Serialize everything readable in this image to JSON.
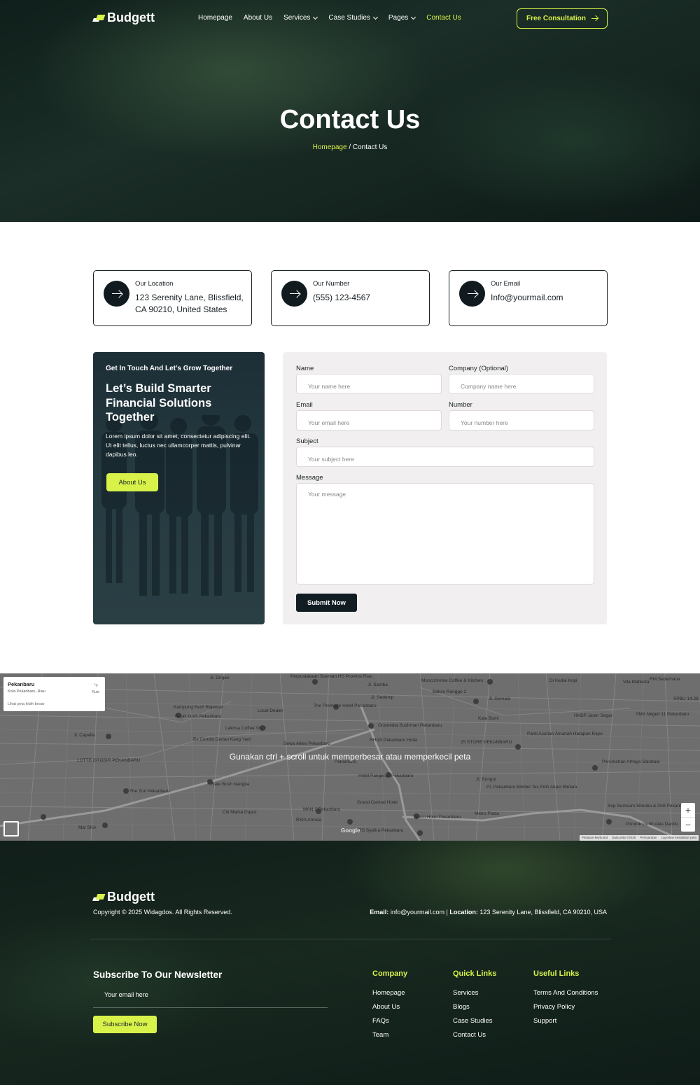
{
  "brand": {
    "name": "Budgett"
  },
  "nav": {
    "items": [
      {
        "label": "Homepage"
      },
      {
        "label": "About Us"
      },
      {
        "label": "Services"
      },
      {
        "label": "Case Studies"
      },
      {
        "label": "Pages"
      },
      {
        "label": "Contact Us"
      }
    ],
    "cta": "Free Consultation",
    "accent": "#d8f24a"
  },
  "hero": {
    "title": "Contact Us",
    "crumb_home": "Homepage",
    "crumb_sep": " / ",
    "crumb_current": "Contact Us"
  },
  "cards": [
    {
      "label": "Our Location",
      "value": "123 Serenity Lane, Blissfield, CA 90210, United States"
    },
    {
      "label": "Our Number",
      "value": "(555) 123-4567"
    },
    {
      "label": "Our Email",
      "value": "Info@yourmail.com"
    }
  ],
  "promo": {
    "small": "Get In Touch And Let’s Grow Together",
    "title": "Let’s Build Smarter Financial Solutions Together",
    "text": "Lorem ipsum dolor sit amet, consectetur adipiscing elit. Ut elit tellus, luctus nec ullamcorper mattis, pulvinar dapibus leo.",
    "button": "About Us"
  },
  "form": {
    "name_label": "Name",
    "name_ph": "Your name here",
    "company_label": "Company (Optional)",
    "company_ph": "Company name here",
    "email_label": "Email",
    "email_ph": "Your email here",
    "number_label": "Number",
    "number_ph": "Your number here",
    "subject_label": "Subject",
    "subject_ph": "Your subject here",
    "message_label": "Message",
    "message_ph": "Your message",
    "submit": "Submit Now"
  },
  "map": {
    "place": "Pekanbaru",
    "place_sub": "Kota Pekanbaru, Riau",
    "route": "Rute",
    "bigger_map": "Lihat peta lebih besar",
    "hint": "Gunakan ctrl + scroll untuk memperbesar atau memperkecil peta",
    "zoom_in": "+",
    "zoom_out": "−",
    "google": "Google",
    "attrib": [
      "Pintasan keyboard",
      "Data peta ©2025",
      "Persyaratan",
      "Laporkan kesalahan peta"
    ],
    "labels": [
      "Jl. Dirgan",
      "Perpustakaan Soeman HS Provinsi Riau",
      "Jl. Samba",
      "Moncchrome Coffee & Kitchen",
      "Di Kedai Kopi",
      "Vila Mahkota",
      "RM Sederhana",
      "SPBU 14.28",
      "Kampung Kecil Rajawali",
      "The Premiere Hotel Pekanbaru",
      "Jl. Sedemp",
      "Bakso Ronggo 2",
      "Jl. Gemala",
      "HKBP Jaran Segar",
      "SMA Negeri 11 Pekanbaru",
      "Rujak buah Pekanbaru",
      "Local Dealer",
      "Kala Bumi",
      "Jl. Capella",
      "Lakosa Coffee Vol.2",
      "Gramedia Sudirman Pekanbaru",
      "Panti Asuhan Amanah Harapan Rayo",
      "Es Cendol Durian Kang Yadi",
      "Sewa Alkes Pekanbaru",
      "RHAS Pekanbaru Hotel",
      "25 STORE PEKANBARU",
      "LOTTE GROSIR PEKANBARU",
      "Perumahan Athaya Sakatala",
      "Pekanbaru",
      "Hotel Pangeran Pekanbaru",
      "Jl. Bungur",
      "The Zuri Pekanbaru",
      "Sate Bush Nangka",
      "Grand Central Hotel",
      "Pt. Pekanbaru Bimbel Tes Polri Akpol Bintara",
      "Citi Mama Dapur",
      "MAN 2 Pekanbaru",
      "Metro Plaza",
      "Sop Sumsum Shoubu & Grill Pekanbaru",
      "RSIA Annisa",
      "Tjokro Hotel Pekanbaru",
      "Pondok Gurih Alas Dandu",
      "Mal SKA",
      "RS Syafira Pekanbaru"
    ]
  },
  "footer": {
    "copyright": "Copyright © 2025 Widagdos. All Rights Reserved.",
    "email_label": "Email:",
    "email": "info@yourmail.com",
    "sep": "|",
    "location_label": "Location:",
    "location": "123 Serenity Lane, Blissfield, CA 90210, USA",
    "newsletter_title": "Subscribe To Our Newsletter",
    "newsletter_input": "Your email here",
    "newsletter_button": "Subscribe Now",
    "columns": [
      {
        "title": "Company",
        "links": [
          "Homepage",
          "About Us",
          "FAQs",
          "Team"
        ]
      },
      {
        "title": "Quick Links",
        "links": [
          "Services",
          "Blogs",
          "Case Studies",
          "Contact Us"
        ]
      },
      {
        "title": "Useful Links",
        "links": [
          "Terms And Conditions",
          "Privacy Policy",
          "Support"
        ]
      }
    ]
  }
}
